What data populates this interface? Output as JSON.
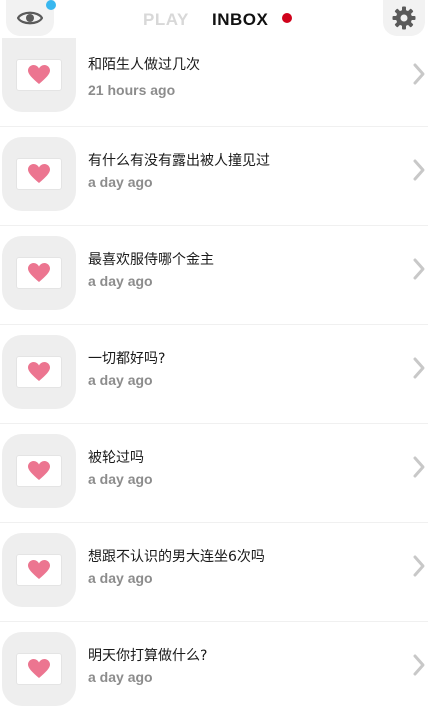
{
  "header": {
    "play_label": "PLAY",
    "inbox_label": "INBOX",
    "left_icon": "eye-icon",
    "right_icon": "gear-icon",
    "colors": {
      "inbox_dot": "#d0021b",
      "eye_dot": "#39b7ef",
      "inactive_tab": "#d8d8d8"
    }
  },
  "messages": [
    {
      "title": "和陌生人做过几次",
      "time": "21 hours ago"
    },
    {
      "title": "有什么有没有露出被人撞见过",
      "time": "a day ago"
    },
    {
      "title": "最喜欢服侍哪个金主",
      "time": "a day ago"
    },
    {
      "title": "一切都好吗?",
      "time": "a day ago"
    },
    {
      "title": "被轮过吗",
      "time": "a day ago"
    },
    {
      "title": "想跟不认识的男大连坐6次吗",
      "time": "a day ago"
    },
    {
      "title": "明天你打算做什么?",
      "time": "a day ago"
    }
  ],
  "item_icon": "heart-envelope-icon",
  "accent": {
    "heart": "#ec7590",
    "chevron": "#c8c8c8"
  }
}
